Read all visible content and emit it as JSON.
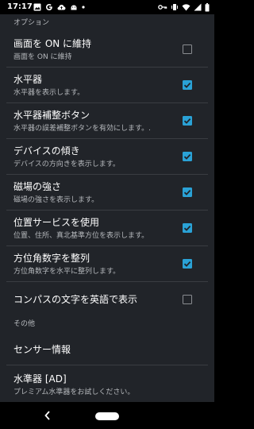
{
  "status_bar": {
    "time": "17:17",
    "left_icons": [
      "image-icon",
      "google-icon",
      "cloud-upload-icon",
      "android-icon",
      "dot-icon"
    ],
    "right_icons": [
      "key-icon",
      "vibrate-icon",
      "wifi-icon",
      "signal-icon",
      "battery-icon"
    ]
  },
  "colors": {
    "background": "#212429",
    "accent_checkbox": "#2aa2d6",
    "section_header_text": "#b9bcc0"
  },
  "sections": {
    "options": {
      "header": "オプション"
    },
    "other": {
      "header": "その他"
    }
  },
  "settings": [
    {
      "title": "画面を ON に維持",
      "summary": "画面を ON に維持",
      "checked": false
    },
    {
      "title": "水平器",
      "summary": "水平器を表示します。",
      "checked": true
    },
    {
      "title": "水平器補整ボタン",
      "summary": "水平器の誤差補整ボタンを有効にします。.",
      "checked": true
    },
    {
      "title": "デバイスの傾き",
      "summary": "デバイスの方向きを表示します。",
      "checked": true
    },
    {
      "title": "磁場の強さ",
      "summary": "磁場の強さを表示します。",
      "checked": true
    },
    {
      "title": "位置サービスを使用",
      "summary": "位置、住所、真北基準方位を表示します。",
      "checked": true
    },
    {
      "title": "方位角数字を整列",
      "summary": "方位角数字を水平に整列します。",
      "checked": true
    },
    {
      "title": "コンパスの文字を英語で表示",
      "checked": false
    }
  ],
  "other_items": [
    {
      "title": "センサー情報"
    },
    {
      "title": "水準器 [AD]",
      "summary": "プレミアム水準器をお試しください。"
    }
  ],
  "nav_bar": {
    "back_icon": "back-chevron-icon",
    "home_icon": "home-pill-icon"
  }
}
